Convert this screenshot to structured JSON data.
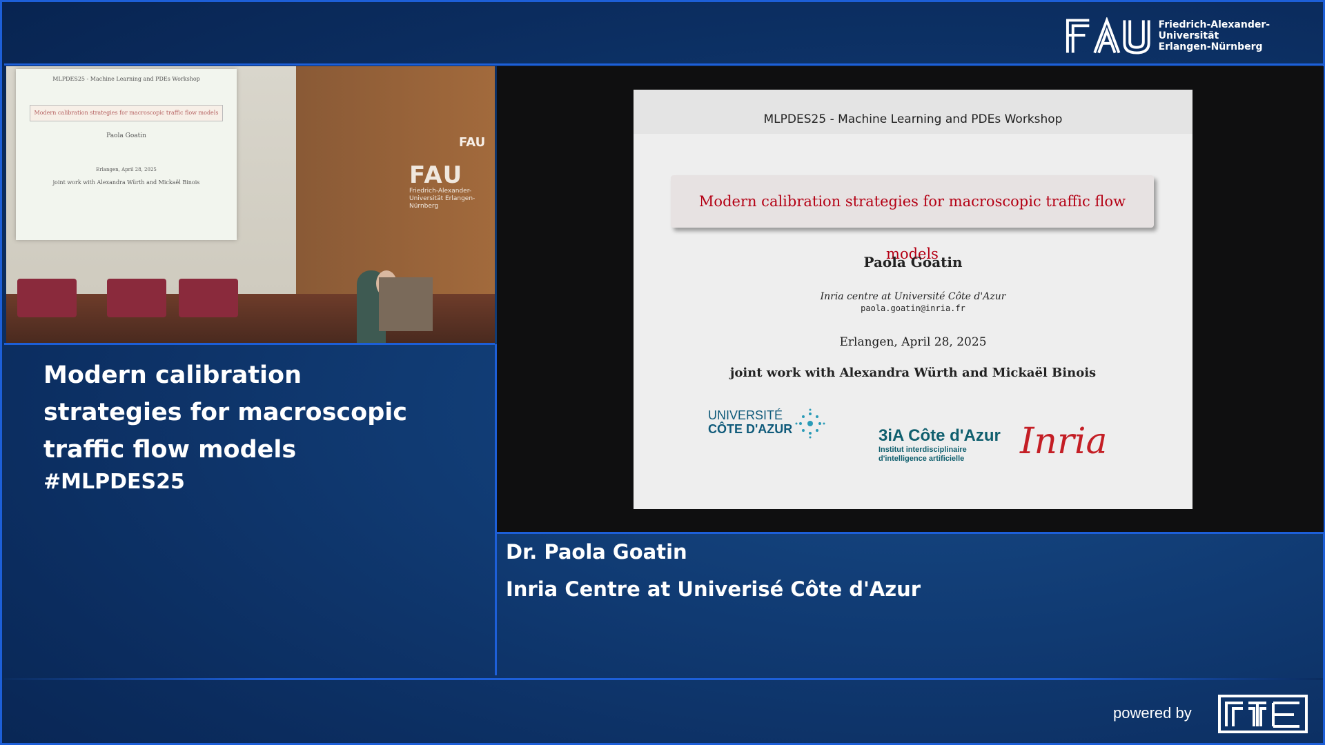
{
  "header": {
    "logo_text_line1": "Friedrich-Alexander-Universität",
    "logo_text_line2": "Erlangen-Nürnberg"
  },
  "talk": {
    "title": "Modern calibration strategies for macroscopic traffic flow models",
    "hashtag": "#MLPDES25"
  },
  "camera": {
    "screen_head": "MLPDES25 - Machine Learning and PDEs Workshop",
    "screen_title": "Modern calibration strategies for macroscopic traffic flow models",
    "screen_author": "Paola Goatin",
    "screen_date": "Erlangen, April 28, 2025",
    "screen_joint": "joint work with Alexandra Würth and Mickaël Binois",
    "wall_logo": "FAU",
    "wall_small_logo": "FAU",
    "wall_text": "Friedrich-Alexander-Universität Erlangen-Nürnberg"
  },
  "slide": {
    "workshop": "MLPDES25 - Machine Learning and PDEs Workshop",
    "title": "Modern calibration strategies for macroscopic traffic flow models",
    "author": "Paola Goatin",
    "institution": "Inria centre at Université Côte d'Azur",
    "email": "paola.goatin@inria.fr",
    "date": "Erlangen, April 28, 2025",
    "joint": "joint work with Alexandra Würth and Mickaël Binois",
    "logo_uca_line1": "UNIVERSITÉ",
    "logo_uca_line2": "CÔTE D'AZUR",
    "logo_3ia_big": "3iA Côte d'Azur",
    "logo_3ia_line1": "Institut interdisciplinaire",
    "logo_3ia_line2": "d'intelligence artificielle",
    "logo_inria": "Inria"
  },
  "speaker": {
    "name": "Dr. Paola Goatin",
    "institution": "Inria Centre at Univerisé Côte d'Azur"
  },
  "footer": {
    "powered_by": "powered by"
  },
  "colors": {
    "accent_blue": "#1d5fd8",
    "slide_title_red": "#b40014",
    "inria_red": "#c41e25"
  }
}
